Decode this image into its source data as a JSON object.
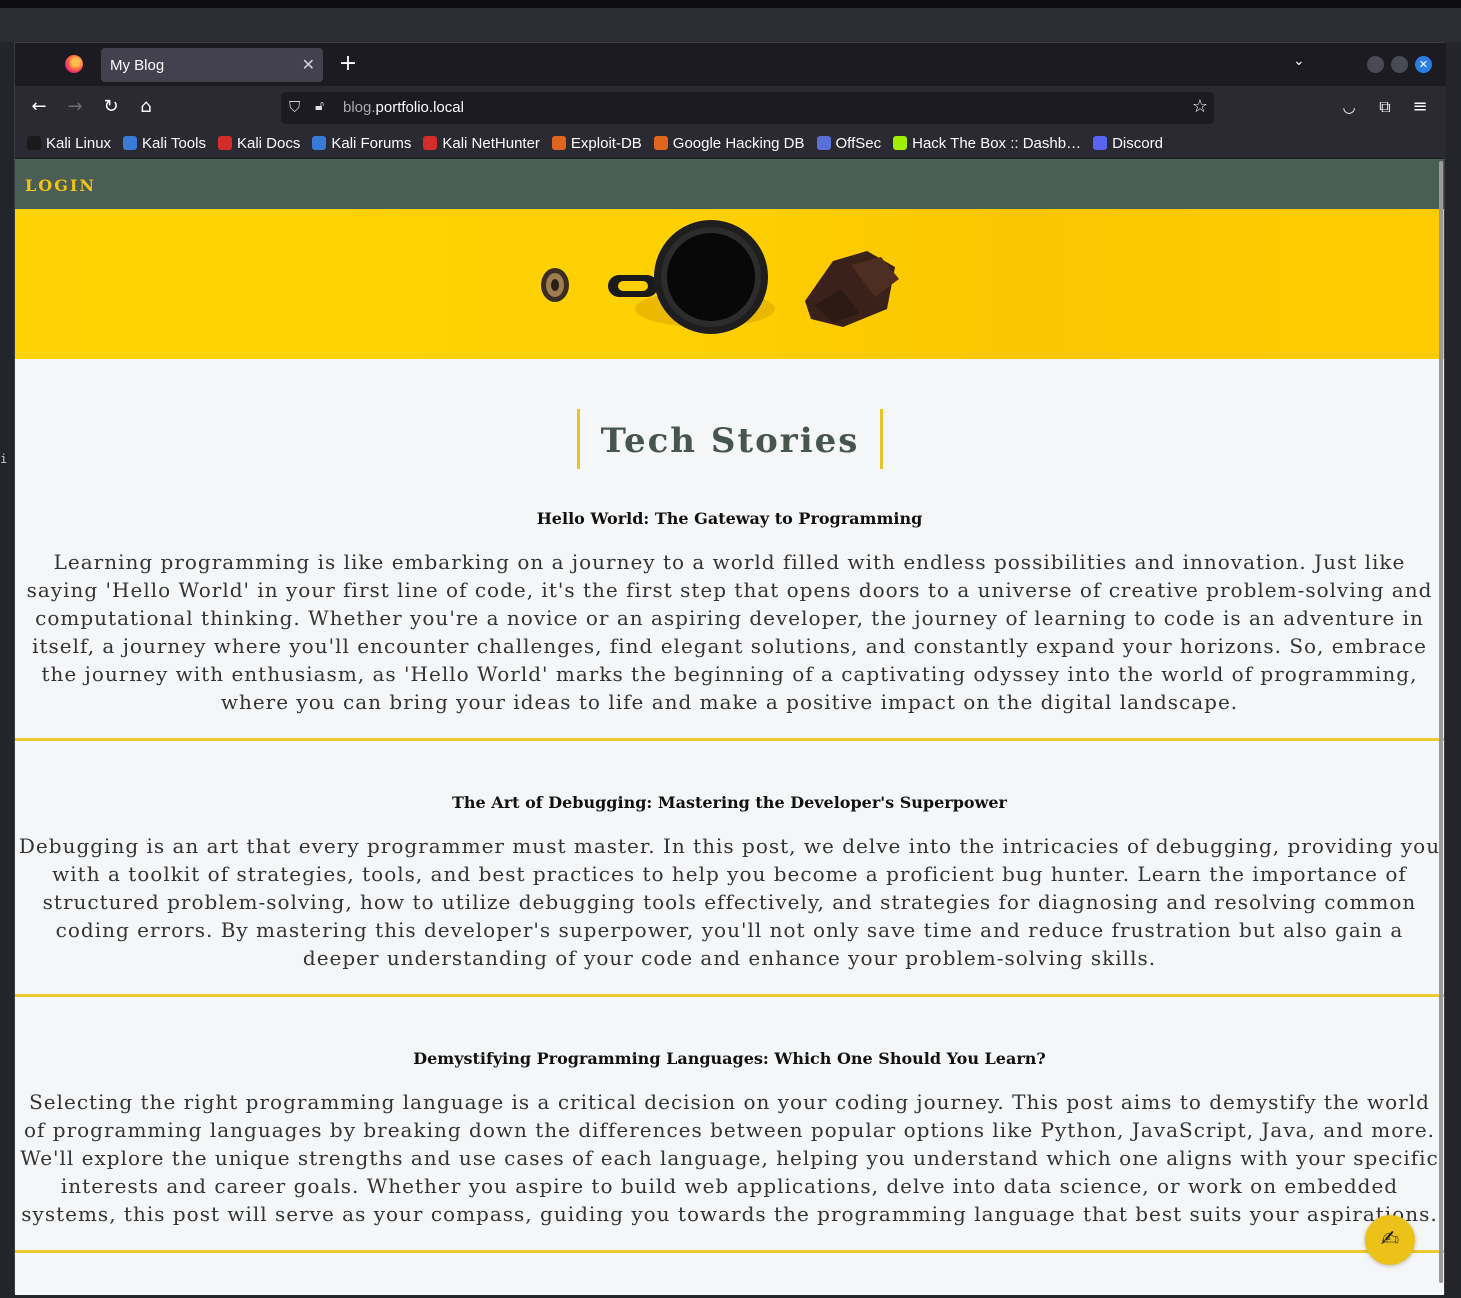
{
  "browser": {
    "tab_title": "My Blog",
    "url_subdomain": "blog.",
    "url_domain": "portfolio.local",
    "bookmarks": [
      {
        "label": "Kali Linux",
        "icon": "kali-dragon-icon",
        "color": "#1a1a1a"
      },
      {
        "label": "Kali Tools",
        "icon": "kali-tools-icon",
        "color": "#3a7bd5"
      },
      {
        "label": "Kali Docs",
        "icon": "kali-docs-icon",
        "color": "#d42b2b"
      },
      {
        "label": "Kali Forums",
        "icon": "kali-forums-icon",
        "color": "#3a7bd5"
      },
      {
        "label": "Kali NetHunter",
        "icon": "nethunter-icon",
        "color": "#d42b2b"
      },
      {
        "label": "Exploit-DB",
        "icon": "exploit-db-icon",
        "color": "#e0661f"
      },
      {
        "label": "Google Hacking DB",
        "icon": "ghdb-icon",
        "color": "#e0661f"
      },
      {
        "label": "OffSec",
        "icon": "offsec-icon",
        "color": "#5a6fd8"
      },
      {
        "label": "Hack The Box :: Dashb…",
        "icon": "htb-cube-icon",
        "color": "#9fef00"
      },
      {
        "label": "Discord",
        "icon": "discord-icon",
        "color": "#5865f2"
      }
    ]
  },
  "site": {
    "login_label": "LOGIN",
    "heading": "Tech Stories",
    "fab_icon": "✍",
    "posts": [
      {
        "title": "Hello World: The Gateway to Programming",
        "body": "Learning programming is like embarking on a journey to a world filled with endless possibilities and innovation. Just like saying 'Hello World' in your first line of code, it's the first step that opens doors to a universe of creative problem-solving and computational thinking. Whether you're a novice or an aspiring developer, the journey of learning to code is an adventure in itself, a journey where you'll encounter challenges, find elegant solutions, and constantly expand your horizons. So, embrace the journey with enthusiasm, as 'Hello World' marks the beginning of a captivating odyssey into the world of programming, where you can bring your ideas to life and make a positive impact on the digital landscape."
      },
      {
        "title": "The Art of Debugging: Mastering the Developer's Superpower",
        "body": "Debugging is an art that every programmer must master. In this post, we delve into the intricacies of debugging, providing you with a toolkit of strategies, tools, and best practices to help you become a proficient bug hunter. Learn the importance of structured problem-solving, how to utilize debugging tools effectively, and strategies for diagnosing and resolving common coding errors. By mastering this developer's superpower, you'll not only save time and reduce frustration but also gain a deeper understanding of your code and enhance your problem-solving skills."
      },
      {
        "title": "Demystifying Programming Languages: Which One Should You Learn?",
        "body": "Selecting the right programming language is a critical decision on your coding journey. This post aims to demystify the world of programming languages by breaking down the differences between popular options like Python, JavaScript, Java, and more. We'll explore the unique strengths and use cases of each language, helping you understand which one aligns with your specific interests and career goals. Whether you aspire to build web applications, delve into data science, or work on embedded systems, this post will serve as your compass, guiding you towards the programming language that best suits your aspirations."
      }
    ]
  },
  "colors": {
    "nav_bg": "#4b5e56",
    "accent_yellow": "#f2c413",
    "heading_color": "#46564f"
  }
}
